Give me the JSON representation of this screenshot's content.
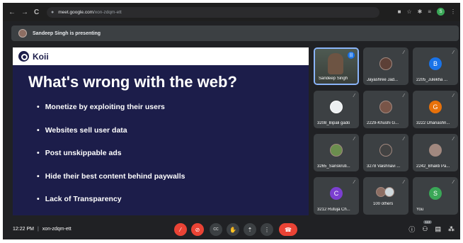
{
  "browser": {
    "url_host": "meet.google.com",
    "url_path": "/xon-zdqm-ett",
    "profile_initial": "S"
  },
  "banner": {
    "text": "Sandeep Singh is presenting"
  },
  "slide": {
    "brand": "Koii",
    "title": "What's wrong with the web?",
    "bullets": [
      "Monetize by exploiting their users",
      "Websites sell user data",
      "Post unskippable ads",
      "Hide their best content behind paywalls",
      "Lack of Transparency"
    ]
  },
  "participants": [
    {
      "name": "Sandeep Singh",
      "type": "video",
      "speaking": true
    },
    {
      "name": "Jayashree Jad...",
      "type": "photo",
      "muted": true
    },
    {
      "name": "2205_Julekha ...",
      "type": "letter",
      "initial": "B",
      "color": "#1a73e8",
      "muted": true
    },
    {
      "name": "3208_Bipali gado",
      "type": "photo",
      "muted": true
    },
    {
      "name": "2229-Khushi G...",
      "type": "photo",
      "muted": true
    },
    {
      "name": "3222 Dhanashri...",
      "type": "letter",
      "initial": "G",
      "color": "#e8710a",
      "muted": true
    },
    {
      "name": "3265_Sanskruti...",
      "type": "photo",
      "muted": true
    },
    {
      "name": "3278 Vaishnavi ...",
      "type": "photo",
      "muted": true
    },
    {
      "name": "2242_Bhakti Pa...",
      "type": "photo",
      "muted": true
    },
    {
      "name": "3212 Rutuja Ch...",
      "type": "letter",
      "initial": "C",
      "color": "#7b3fd0",
      "muted": true
    },
    {
      "name": "100 others",
      "type": "group",
      "muted": true
    },
    {
      "name": "You",
      "type": "letter",
      "initial": "S",
      "color": "#3aa757",
      "muted": true
    }
  ],
  "bottom_bar": {
    "time": "12:22 PM",
    "meeting_code": "xon-zdqm-ett",
    "participant_count": "113"
  },
  "icons": {
    "back": "←",
    "forward": "→",
    "reload": "C",
    "lock": "🔒",
    "mic_off": "🎙",
    "cam_off": "📷",
    "captions": "CC",
    "hand": "✋",
    "present": "⬆",
    "more": "⋮",
    "leave": "☎",
    "info": "ⓘ",
    "people": "👥",
    "chat": "💬",
    "activities": "⚙"
  }
}
